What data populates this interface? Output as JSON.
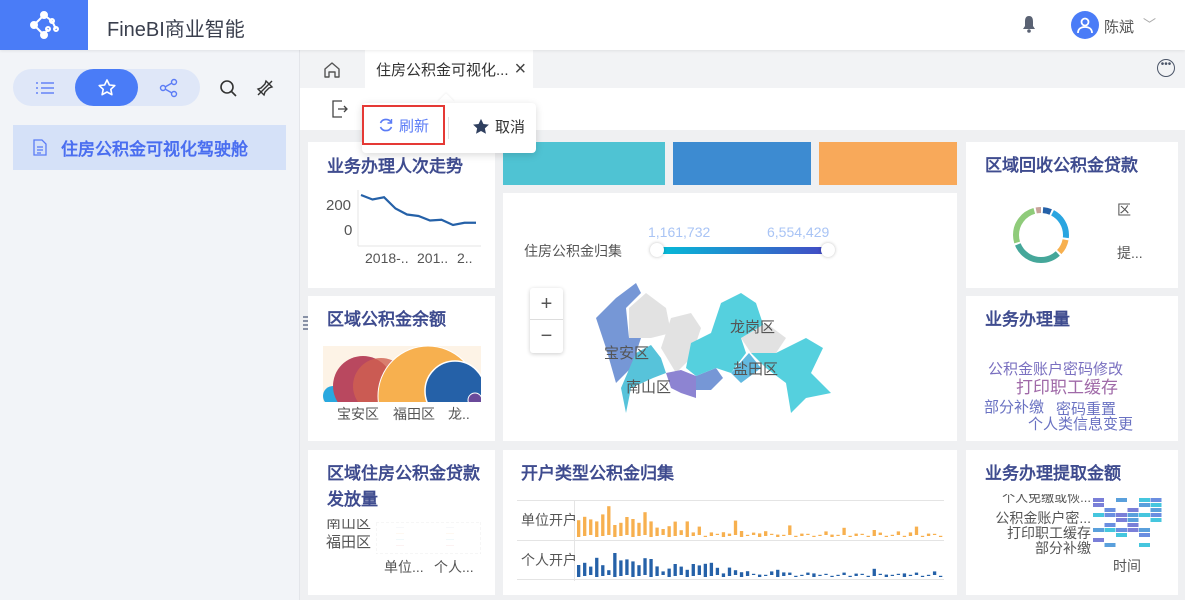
{
  "header": {
    "app_title": "FineBI商业智能",
    "user_name": "陈斌"
  },
  "sidebar": {
    "items": [
      {
        "label": "住房公积金可视化驾驶舱"
      }
    ]
  },
  "tabs": {
    "active": "住房公积金可视化..."
  },
  "popup": {
    "refresh_label": "刷新",
    "cancel_label": "取消"
  },
  "colors": {
    "brand": "#4a7cf7",
    "highlight": "#e53935",
    "title": "#3f4c8f"
  },
  "cards": {
    "trend": {
      "title": "业务办理人次走势",
      "yticks": [
        "200",
        "0"
      ],
      "xticks": [
        "2018-..",
        "201..",
        "2.."
      ]
    },
    "balance": {
      "title": "区域公积金余额",
      "xticks": [
        "宝安区",
        "福田区",
        "龙.."
      ]
    },
    "loan_issue": {
      "title": "区域住房公积金贷款发放量",
      "rows": [
        "南山区",
        "福田区"
      ],
      "cols": [
        "单位...",
        "个人..."
      ]
    },
    "map": {
      "legend_label": "住房公积金归集",
      "min": "1,161,732",
      "max": "6,554,429",
      "zoom_in": "+",
      "zoom_out": "−",
      "regions": [
        "宝安区",
        "南山区",
        "龙岗区",
        "盐田区"
      ]
    },
    "account_type": {
      "title": "开户类型公积金归集",
      "rows": [
        "单位开户",
        "个人开户"
      ],
      "unit": [
        28,
        32,
        26,
        26,
        36,
        48,
        20,
        22,
        30,
        30,
        22,
        38,
        26,
        14,
        10,
        18,
        24,
        8,
        26,
        6,
        14,
        2,
        6,
        2,
        8,
        4,
        24,
        10,
        2,
        4,
        6,
        8,
        2,
        4,
        2,
        16,
        2,
        4,
        2,
        2,
        2,
        6,
        4,
        2,
        12,
        2,
        4,
        2,
        2,
        10,
        4,
        2,
        2,
        6,
        2,
        6,
        14,
        2,
        4,
        2,
        2
      ],
      "personal": [
        20,
        22,
        14,
        32,
        18,
        8,
        40,
        26,
        26,
        26,
        18,
        28,
        30,
        16,
        6,
        14,
        20,
        14,
        12,
        20,
        16,
        22,
        22,
        12,
        6,
        14,
        8,
        8,
        8,
        2,
        4,
        2,
        6,
        12,
        6,
        4,
        2,
        2,
        4,
        6,
        2,
        2,
        2,
        2,
        4,
        2,
        4,
        2,
        2,
        12,
        2,
        4,
        2,
        2,
        6,
        2,
        4,
        2,
        2,
        6,
        2
      ]
    },
    "recovery": {
      "title": "区域回收公积金贷款",
      "legend": [
        "区",
        "提..."
      ]
    },
    "volume": {
      "title": "业务办理量",
      "words": [
        "公积金账户密码修改",
        "打印职工缓存",
        "部分补缴",
        "密码重置",
        "个人类信息变更"
      ]
    },
    "withdraw": {
      "title": "业务办理提取金额",
      "rows": [
        "个人免缴或恢...",
        "公积金账户密...",
        "打印职工缓存",
        "部分补缴"
      ],
      "xlabel": "时间"
    }
  },
  "trend_values": [
    260,
    230,
    245,
    170,
    130,
    120,
    90,
    95,
    60,
    75,
    75
  ]
}
